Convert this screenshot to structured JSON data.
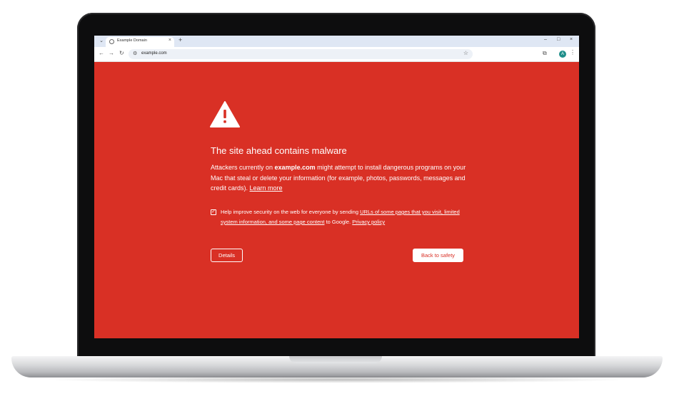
{
  "browser": {
    "tab_title": "Example Domain",
    "new_tab_label": "+",
    "address": "example.com",
    "avatar_initial": "A"
  },
  "interstitial": {
    "heading": "The site ahead contains malware",
    "para_prefix": "Attackers currently on ",
    "site": "example.com",
    "para_body": " might attempt to install dangerous programs on your Mac that steal or delete your information (for example, photos, passwords, messages and credit cards). ",
    "learn_more": "Learn more",
    "checkbox_checked": true,
    "checkbox_prefix": "Help improve security on the web for everyone by sending ",
    "checkbox_link": "URLs of some pages that you visit, limited system information, and some page content",
    "checkbox_middle": " to Google. ",
    "privacy_link": "Privacy policy",
    "details_button": "Details",
    "back_button": "Back to safety"
  },
  "colors": {
    "danger_red": "#d93025",
    "tab_bar": "#dfe7f4",
    "omnibox": "#edf1f7"
  },
  "icons": [
    "tab-search-icon",
    "globe-icon",
    "close-icon",
    "back-arrow-icon",
    "forward-arrow-icon",
    "reload-icon",
    "site-settings-icon",
    "bookmark-star-icon",
    "extensions-icon",
    "menu-kebab-icon",
    "warning-triangle-icon",
    "checkmark-icon"
  ]
}
